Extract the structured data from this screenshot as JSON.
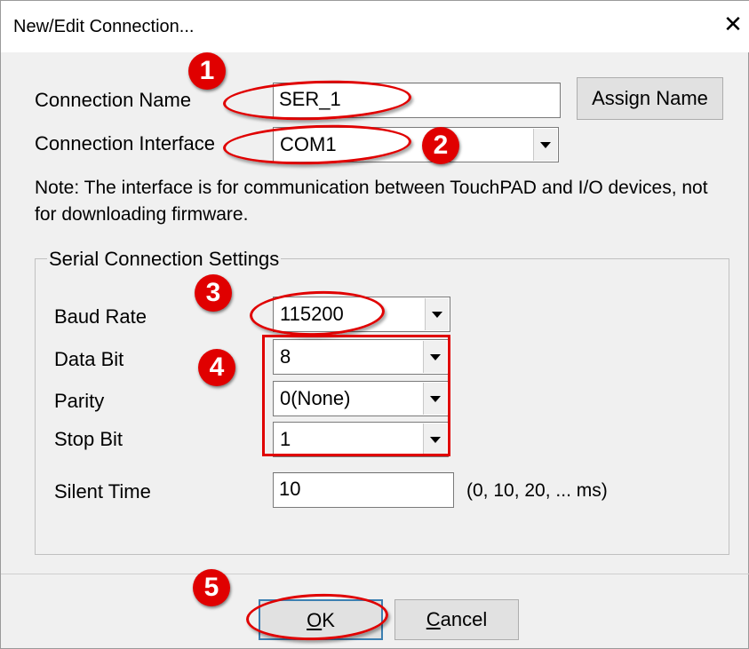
{
  "window": {
    "title": "New/Edit Connection...",
    "close_glyph": "✕"
  },
  "connection": {
    "name_label": "Connection Name",
    "name_value": "SER_1",
    "assign_button": "Assign Name",
    "interface_label": "Connection Interface",
    "interface_value": "COM1"
  },
  "note": "Note: The interface is for communication between TouchPAD and I/O devices, not for downloading firmware.",
  "serial": {
    "group_title": "Serial Connection Settings",
    "baud_label": "Baud Rate",
    "baud_value": "115200",
    "data_bit_label": "Data Bit",
    "data_bit_value": "8",
    "parity_label": "Parity",
    "parity_value": "0(None)",
    "stop_bit_label": "Stop Bit",
    "stop_bit_value": "1",
    "silent_label": "Silent Time",
    "silent_value": "10",
    "silent_hint": "(0, 10, 20, ... ms)"
  },
  "buttons": {
    "ok_mnemonic": "O",
    "ok_rest": "K",
    "cancel_mnemonic": "C",
    "cancel_rest": "ancel"
  },
  "annotations": {
    "color": "#e00000",
    "markers": [
      "1",
      "2",
      "3",
      "4",
      "5"
    ]
  }
}
